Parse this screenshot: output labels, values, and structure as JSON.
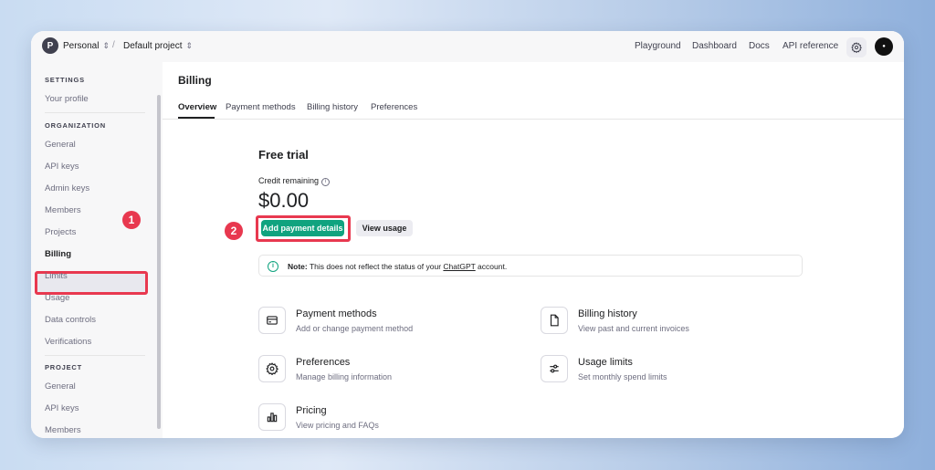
{
  "topbar": {
    "org_initial": "P",
    "org_name": "Personal",
    "separator": "/",
    "project_name": "Default project",
    "links": [
      "Playground",
      "Dashboard",
      "Docs",
      "API reference"
    ]
  },
  "sidebar": {
    "settings_head": "SETTINGS",
    "settings_items": [
      "Your profile"
    ],
    "organization_head": "ORGANIZATION",
    "organization_items": [
      "General",
      "API keys",
      "Admin keys",
      "Members",
      "Projects",
      "Billing",
      "Limits",
      "Usage",
      "Data controls",
      "Verifications"
    ],
    "project_head": "PROJECT",
    "project_items": [
      "General",
      "API keys",
      "Members"
    ],
    "active_item": "Billing"
  },
  "annotations": {
    "step1": "1",
    "step2": "2"
  },
  "main": {
    "title": "Billing",
    "tabs": [
      "Overview",
      "Payment methods",
      "Billing history",
      "Preferences"
    ],
    "active_tab": "Overview",
    "plan_title": "Free trial",
    "credit_label": "Credit remaining",
    "credit_amount": "$0.00",
    "add_payment_label": "Add payment details",
    "view_usage_label": "View usage",
    "note": {
      "bold": "Note:",
      "text_before": " This does not reflect the status of your ",
      "link": "ChatGPT",
      "text_after": " account."
    },
    "cards": [
      {
        "title": "Payment methods",
        "desc": "Add or change payment method",
        "icon": "credit-card-icon"
      },
      {
        "title": "Billing history",
        "desc": "View past and current invoices",
        "icon": "document-icon"
      },
      {
        "title": "Preferences",
        "desc": "Manage billing information",
        "icon": "gear-icon"
      },
      {
        "title": "Usage limits",
        "desc": "Set monthly spend limits",
        "icon": "sliders-icon"
      },
      {
        "title": "Pricing",
        "desc": "View pricing and FAQs",
        "icon": "bar-chart-icon"
      }
    ]
  },
  "colors": {
    "accent": "#10a37f",
    "highlight": "#e8384f"
  }
}
